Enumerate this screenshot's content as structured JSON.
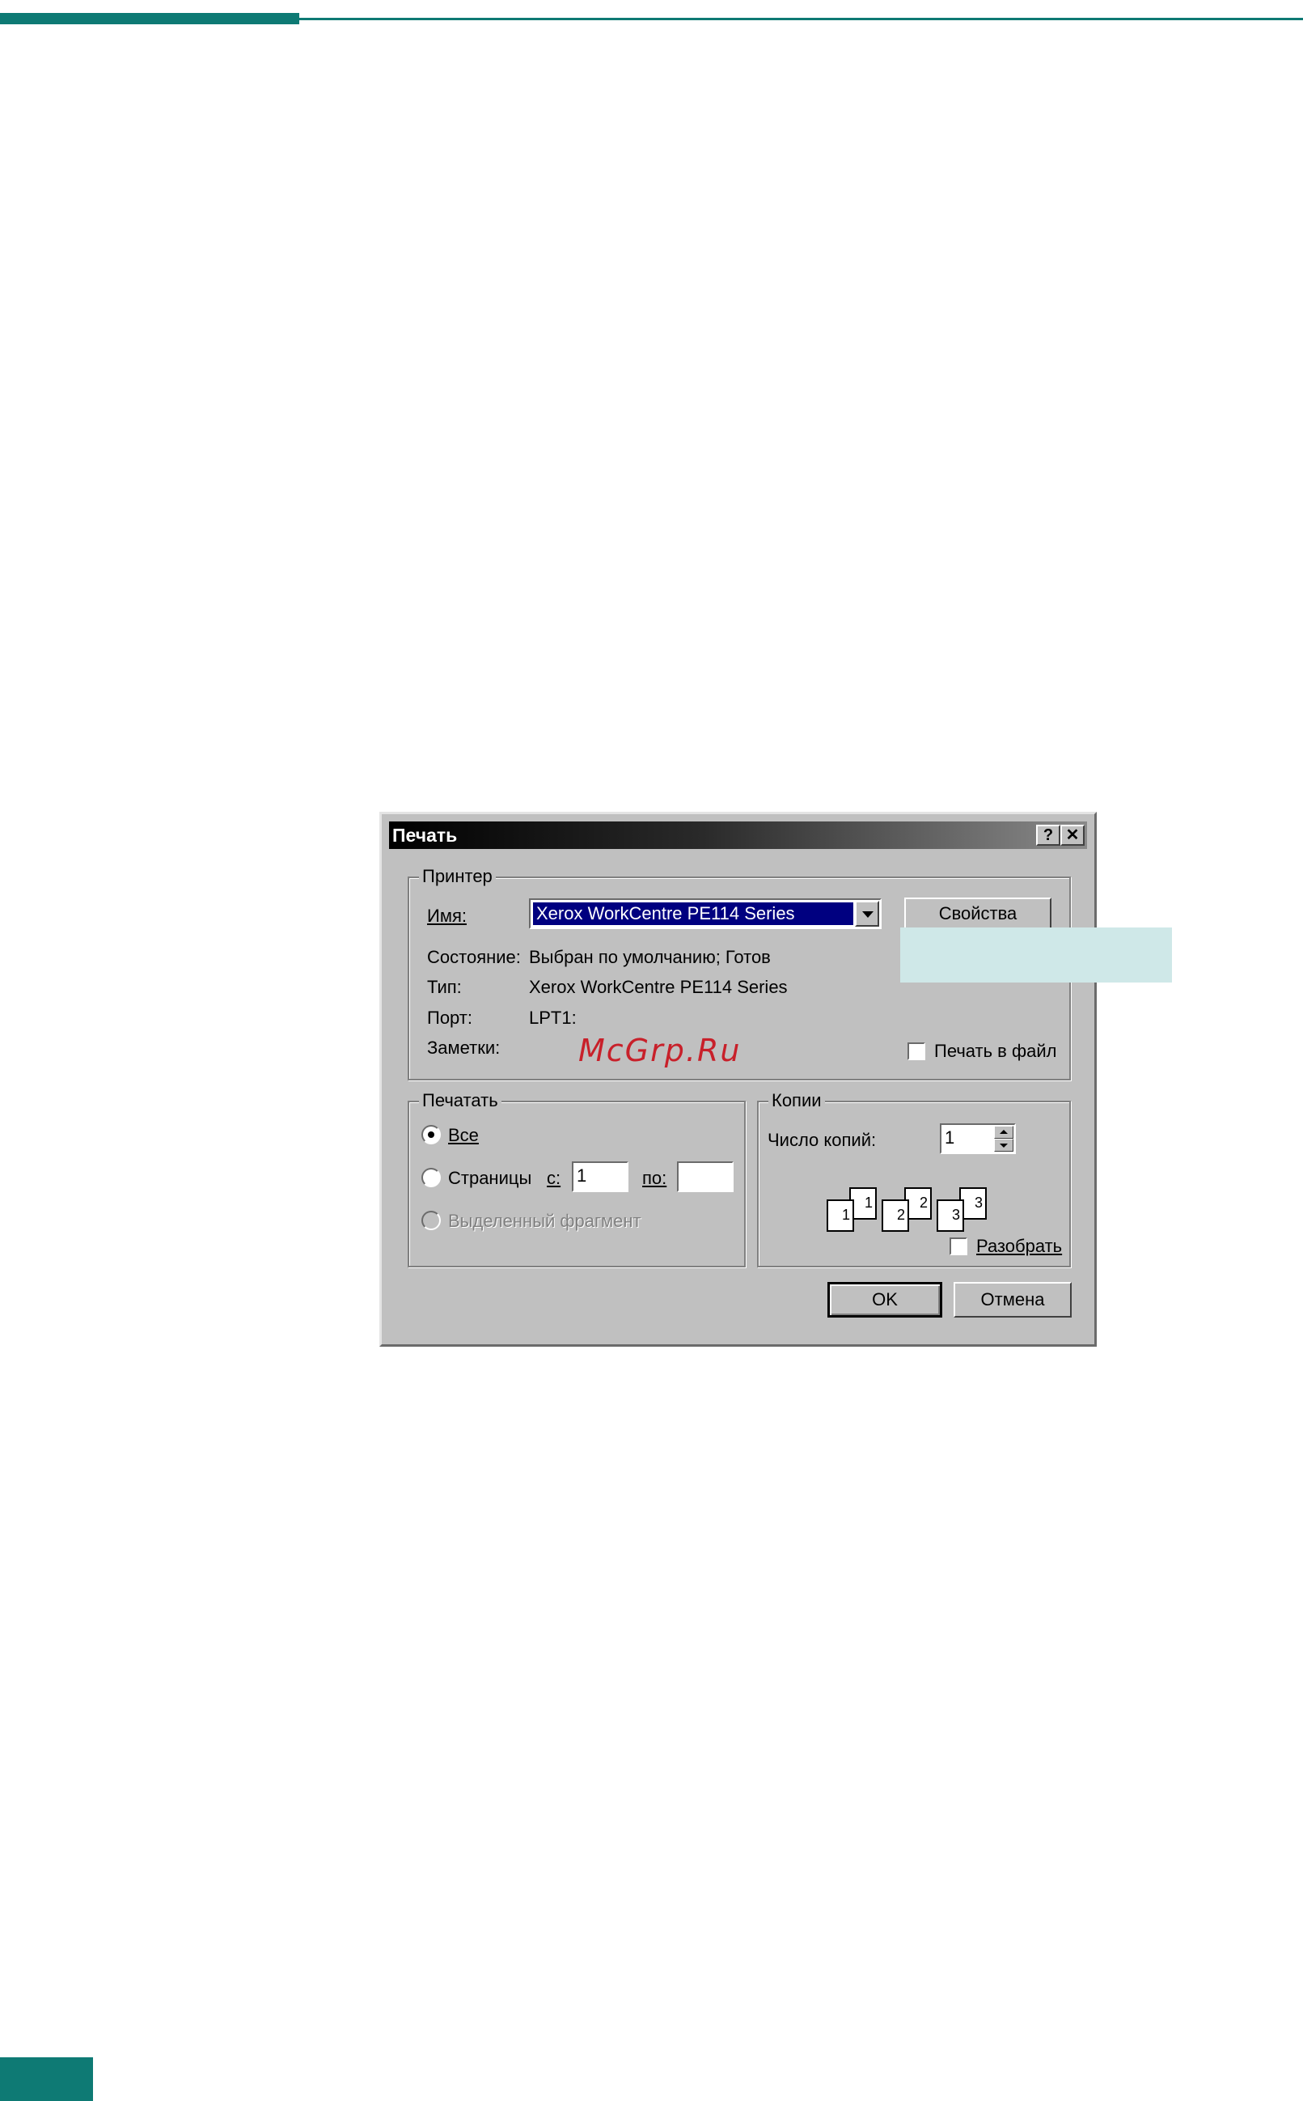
{
  "colors": {
    "accent": "#0e7a74",
    "callout": "#cfe8e8",
    "selection": "#000080",
    "watermark": "#c8202a"
  },
  "dialog": {
    "title": "Печать",
    "help_icon": "help-icon",
    "close_icon": "close-icon",
    "printer_group": {
      "title": "Принтер",
      "name_label": "Имя:",
      "name_value": "Xerox WorkCentre PE114 Series",
      "properties_button": "Свойства",
      "status_label": "Состояние:",
      "status_value": "Выбран по умолчанию; Готов",
      "type_label": "Тип:",
      "type_value": "Xerox WorkCentre PE114 Series",
      "port_label": "Порт:",
      "port_value": "LPT1:",
      "notes_label": "Заметки:",
      "print_to_file_label": "Печать в файл",
      "print_to_file_checked": false
    },
    "range_group": {
      "title": "Печатать",
      "all_label": "Все",
      "pages_label": "Страницы",
      "from_label": "с:",
      "from_value": "1",
      "to_label": "по:",
      "to_value": "",
      "selection_label": "Выделенный фрагмент",
      "selected": "all"
    },
    "copies_group": {
      "title": "Копии",
      "count_label": "Число копий:",
      "count_value": "1",
      "collate_label": "Разобрать",
      "collate_checked": false,
      "collate_pages": [
        "1",
        "1",
        "2",
        "2",
        "3",
        "3"
      ]
    },
    "ok_button": "OK",
    "cancel_button": "Отмена"
  },
  "watermark": "McGrp.Ru"
}
